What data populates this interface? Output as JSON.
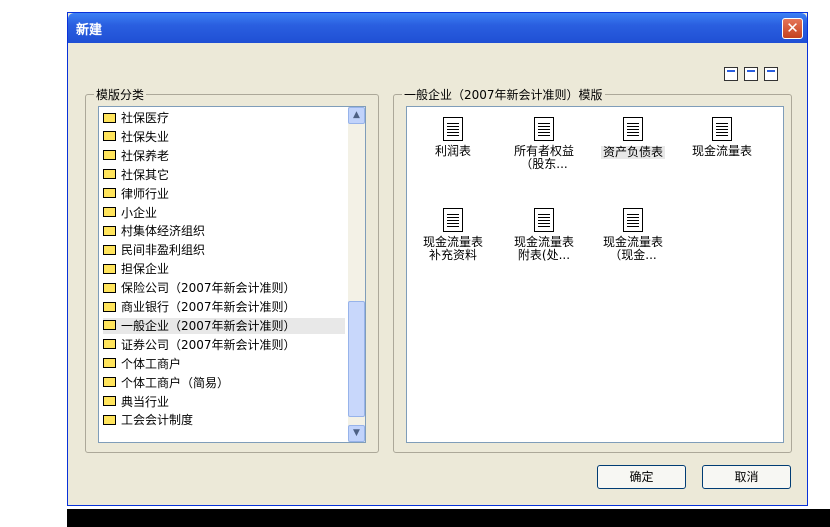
{
  "window": {
    "title": "新建",
    "close_label": "✕"
  },
  "view_icons": [
    "large-icons-view-icon",
    "list-view-icon",
    "details-view-icon"
  ],
  "left_panel": {
    "label": "模版分类",
    "items": [
      "社保医疗",
      "社保失业",
      "社保养老",
      "社保其它",
      "律师行业",
      "小企业",
      "村集体经济组织",
      "民间非盈利组织",
      "担保企业",
      "保险公司（2007年新会计准则）",
      "商业银行（2007年新会计准则）",
      "一般企业（2007年新会计准则）",
      "证券公司（2007年新会计准则）",
      "个体工商户",
      "个体工商户（简易）",
      "典当行业",
      "工会会计制度"
    ],
    "selected_index": 11
  },
  "right_panel": {
    "label": "一般企业（2007年新会计准则）模版",
    "templates": [
      "利润表",
      "所有者权益\n（股东...",
      "资产负债表",
      "现金流量表",
      "现金流量表\n补充资料",
      "现金流量表\n附表(处...",
      "现金流量表\n（现金..."
    ],
    "highlighted_index": 2
  },
  "buttons": {
    "ok": "确定",
    "cancel": "取消"
  },
  "colors": {
    "title_bar": "#2a5fe0",
    "dialog_bg": "#ece9d8",
    "folder": "#ffe45c"
  }
}
